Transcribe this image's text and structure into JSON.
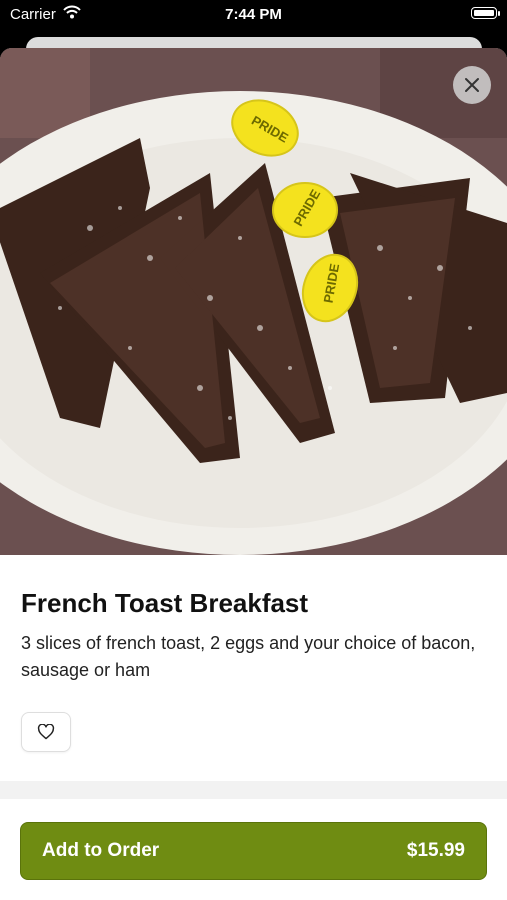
{
  "status_bar": {
    "carrier": "Carrier",
    "time": "7:44 PM"
  },
  "item": {
    "title": "French Toast Breakfast",
    "description": "3 slices of french toast, 2 eggs and your choice of bacon, sausage or ham",
    "image_alt": "French toast with powdered sugar and butter packets",
    "butter_brand": "PRIDE"
  },
  "actions": {
    "add_label": "Add to Order",
    "price": "$15.99"
  },
  "icons": {
    "close": "close-icon",
    "favorite": "heart-icon",
    "wifi": "wifi-icon",
    "battery": "battery-icon"
  },
  "colors": {
    "accent": "#6f8c12"
  }
}
